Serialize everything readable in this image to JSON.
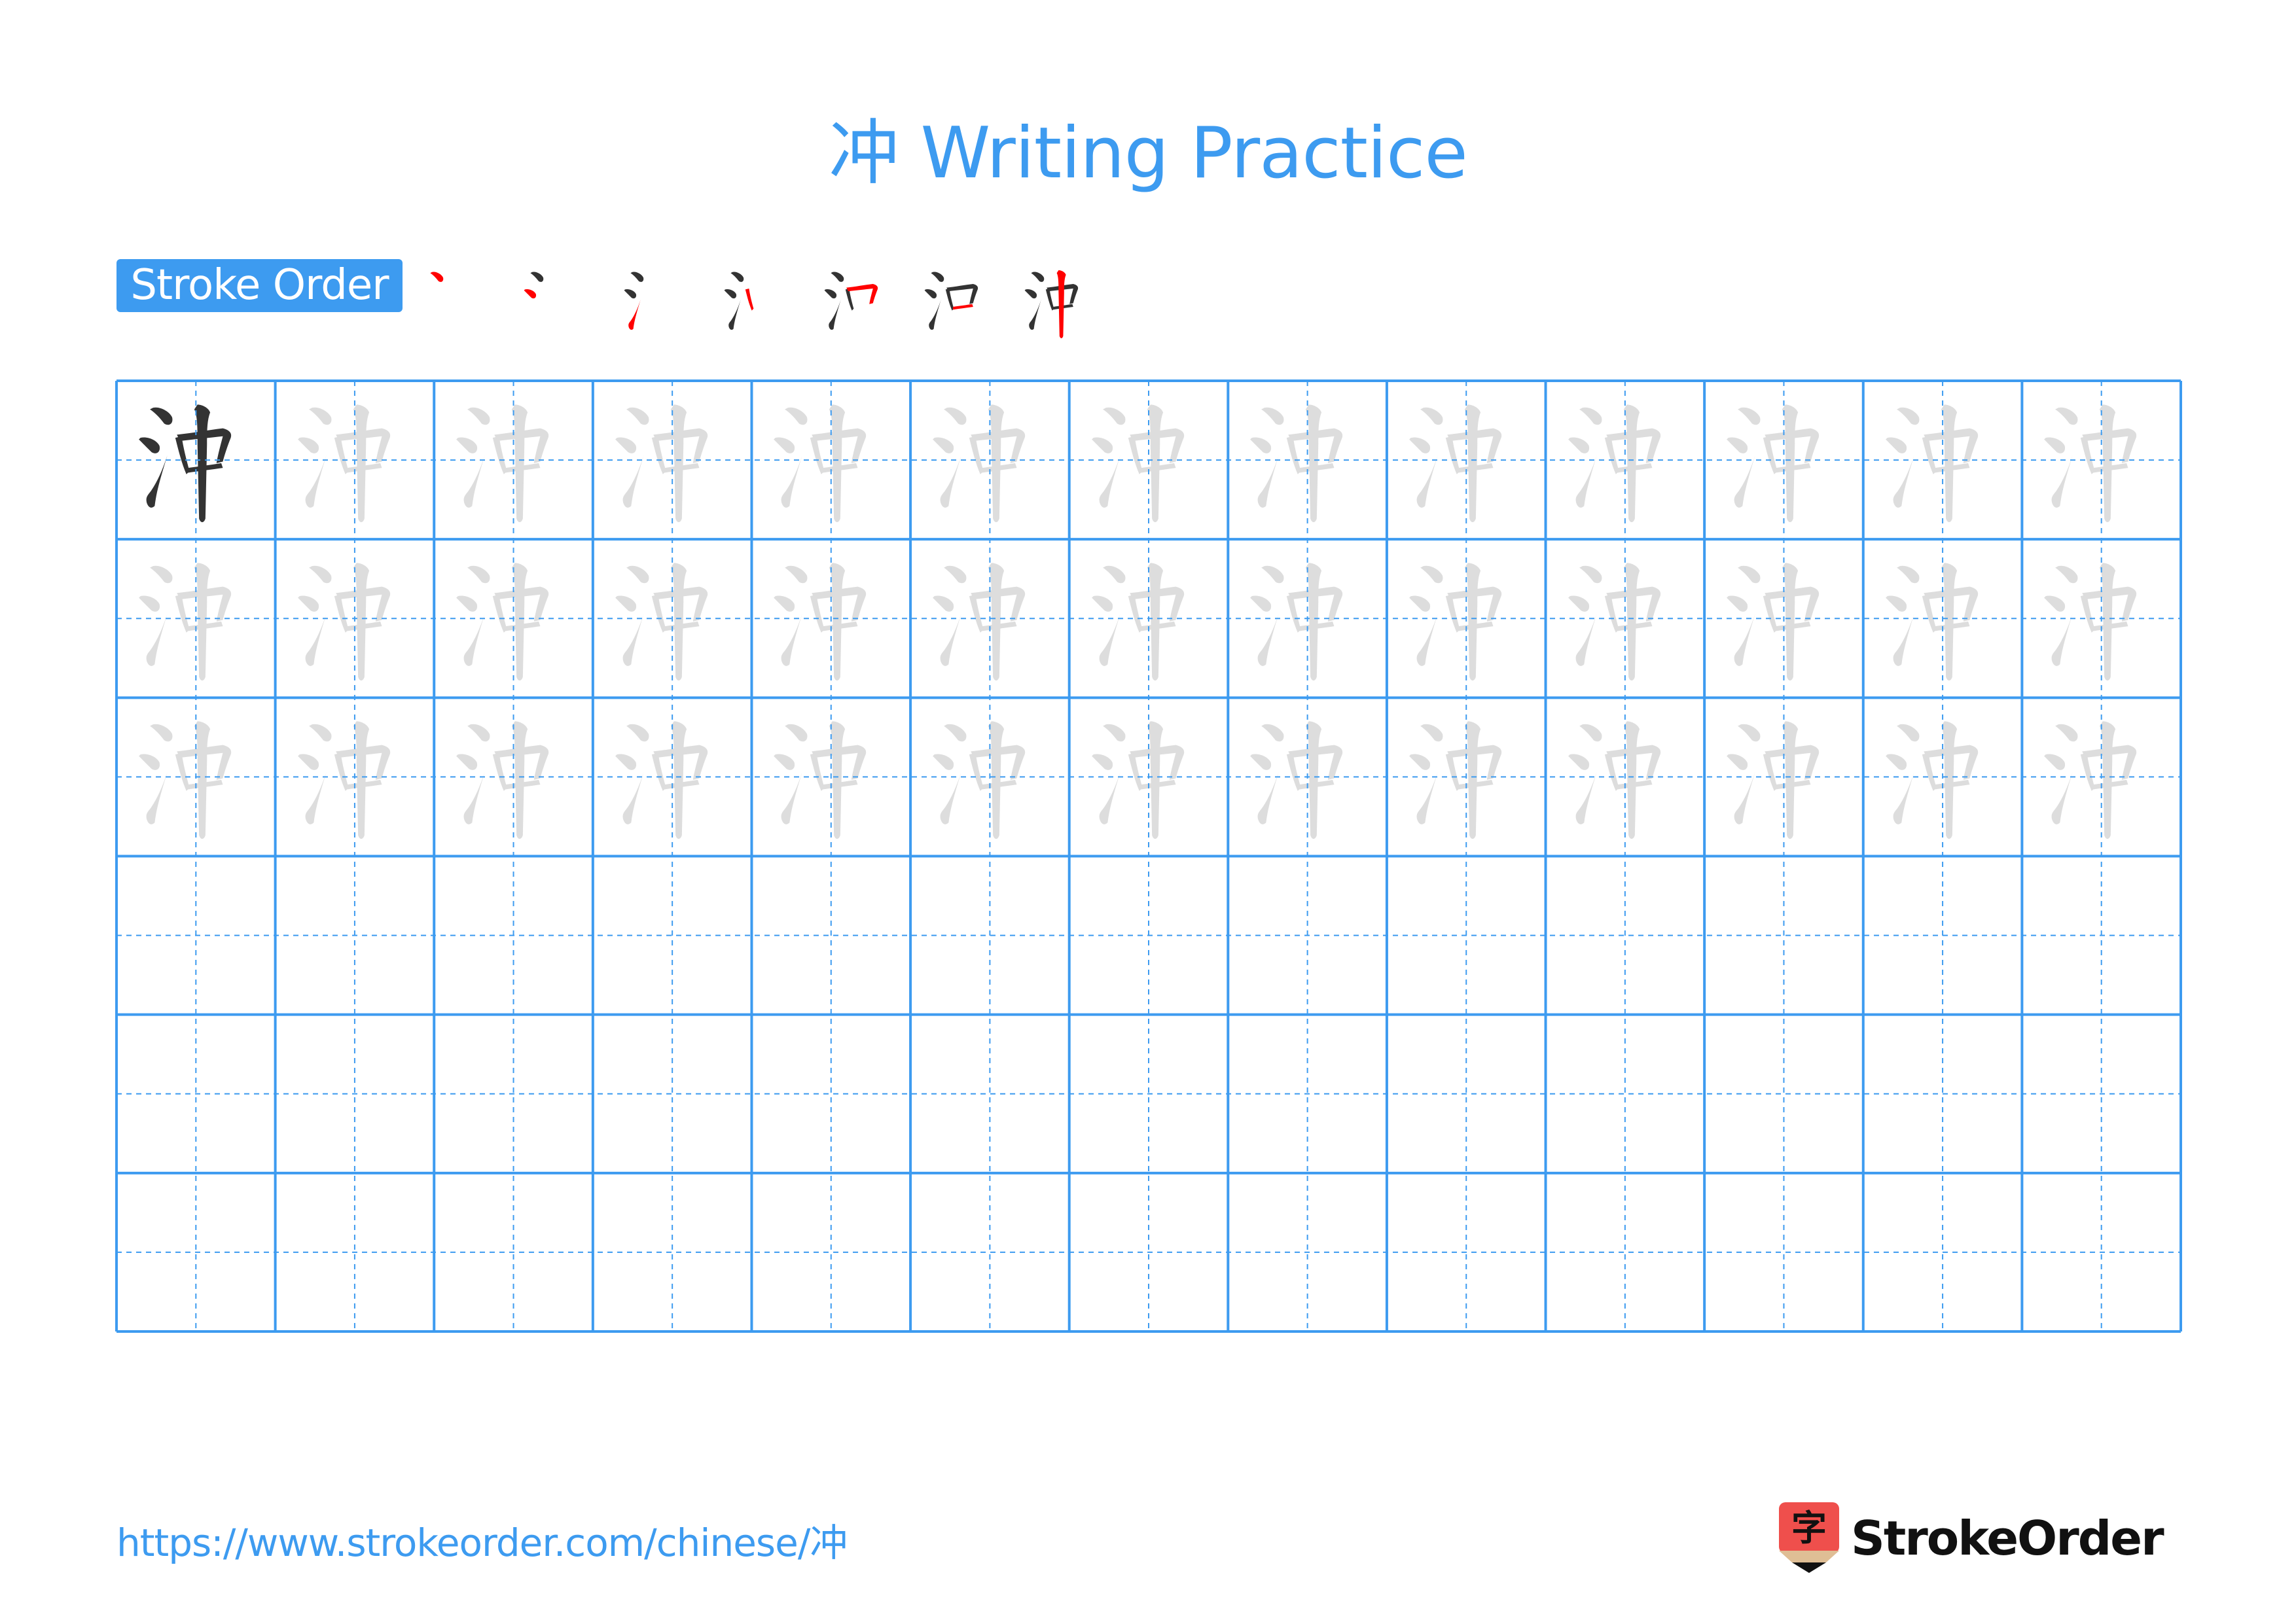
{
  "page": {
    "title": "冲 Writing Practice",
    "character": "冲"
  },
  "stroke_order": {
    "label": "Stroke Order",
    "stroke_count": 7,
    "steps": [
      {
        "step": 1,
        "label": "stroke 1 of 7"
      },
      {
        "step": 2,
        "label": "stroke 2 of 7"
      },
      {
        "step": 3,
        "label": "stroke 3 of 7"
      },
      {
        "step": 4,
        "label": "stroke 4 of 7"
      },
      {
        "step": 5,
        "label": "stroke 5 of 7"
      },
      {
        "step": 6,
        "label": "stroke 6 of 7"
      },
      {
        "step": 7,
        "label": "stroke 7 of 7"
      }
    ]
  },
  "grid": {
    "columns": 13,
    "rows": 6,
    "rows_content": [
      {
        "row": 1,
        "first_cell": "model",
        "rest": "trace"
      },
      {
        "row": 2,
        "first_cell": "trace",
        "rest": "trace"
      },
      {
        "row": 3,
        "first_cell": "trace",
        "rest": "trace"
      },
      {
        "row": 4,
        "first_cell": "empty",
        "rest": "empty"
      },
      {
        "row": 5,
        "first_cell": "empty",
        "rest": "empty"
      },
      {
        "row": 6,
        "first_cell": "empty",
        "rest": "empty"
      }
    ]
  },
  "colors": {
    "accent": "#3d9bf0",
    "model_glyph": "#333333",
    "trace_glyph": "#dddddd",
    "current_stroke": "#ff0000",
    "logo_red": "#ef4f4c",
    "logo_tan": "#dfbe95"
  },
  "footer": {
    "url": "https://www.strokeorder.com/chinese/冲",
    "logo_glyph": "字",
    "logo_text": "StrokeOrder"
  }
}
